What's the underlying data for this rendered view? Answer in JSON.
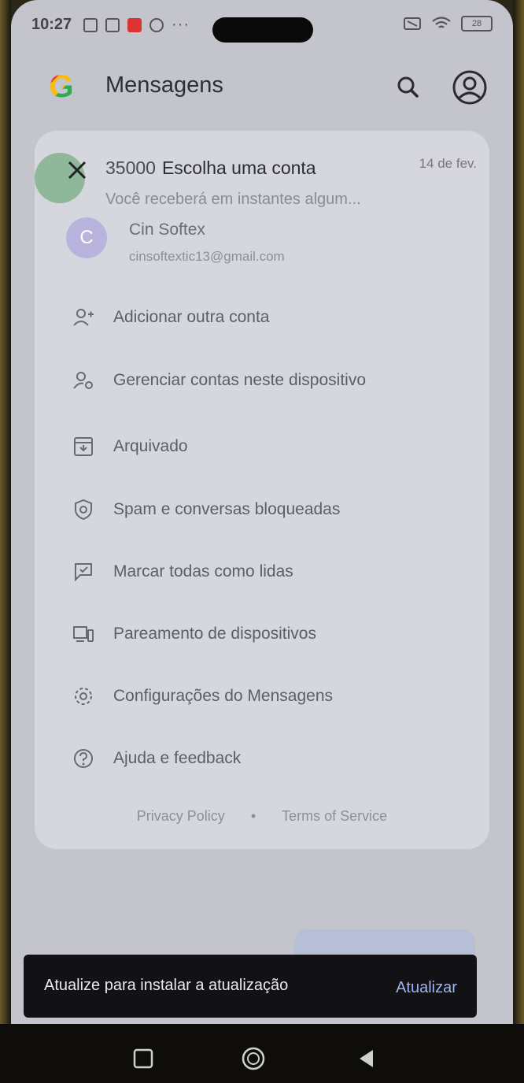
{
  "status_bar": {
    "time": "10:27",
    "dots": "···",
    "battery": "28"
  },
  "app_bar": {
    "logo": "G",
    "title": "Mensagens"
  },
  "account_menu": {
    "message_number": "35000",
    "title": "Escolha uma conta",
    "date": "14 de fev.",
    "preview": "Você receberá em instantes algum...",
    "account": {
      "initial": "C",
      "name": "Cin Softex",
      "email": "cinsoftextic13@gmail.com"
    },
    "items": [
      {
        "label": "Adicionar outra conta",
        "icon": "add-person-icon"
      },
      {
        "label": "Gerenciar contas neste dispositivo",
        "icon": "manage-accounts-icon"
      },
      {
        "label": "Arquivado",
        "icon": "archive-icon"
      },
      {
        "label": "Spam e conversas bloqueadas",
        "icon": "shield-icon"
      },
      {
        "label": "Marcar todas como lidas",
        "icon": "mark-read-icon"
      },
      {
        "label": "Pareamento de dispositivos",
        "icon": "devices-icon"
      },
      {
        "label": "Configurações do Mensagens",
        "icon": "gear-icon"
      },
      {
        "label": "Ajuda e feedback",
        "icon": "help-icon"
      }
    ],
    "footer": {
      "privacy": "Privacy Policy",
      "separator": "•",
      "terms": "Terms of Service"
    }
  },
  "snackbar": {
    "message": "Atualize para instalar a atualização",
    "action": "Atualizar"
  },
  "colors": {
    "screen_bg": "#c3c4cc",
    "card_bg": "#d6d7de",
    "snackbar_bg": "#121214",
    "snackbar_action": "#9fb3f0"
  }
}
